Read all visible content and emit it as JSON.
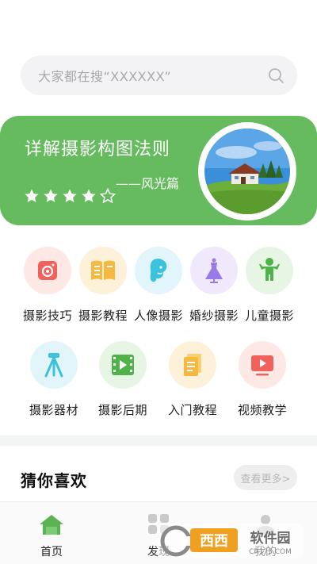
{
  "search": {
    "placeholder": "大家都在搜“XXXXXX”",
    "icon": "search-icon"
  },
  "banner": {
    "title": "详解摄影构图法则",
    "subtitle": "——风光篇",
    "rating": 4,
    "rating_max": 5,
    "bg_color": "#66bb5f"
  },
  "categories": [
    {
      "label": "摄影技巧",
      "icon": "camera-icon",
      "color": "#fde8e6"
    },
    {
      "label": "摄影教程",
      "icon": "book-icon",
      "color": "#fdf1d9"
    },
    {
      "label": "人像摄影",
      "icon": "portrait-icon",
      "color": "#e1f5fb"
    },
    {
      "label": "婚纱摄影",
      "icon": "dress-icon",
      "color": "#efe9fb"
    },
    {
      "label": "儿童摄影",
      "icon": "child-icon",
      "color": "#e6f5e4"
    },
    {
      "label": "摄影器材",
      "icon": "tripod-icon",
      "color": "#e1f5fb"
    },
    {
      "label": "摄影后期",
      "icon": "film-icon",
      "color": "#e6f5e4"
    },
    {
      "label": "入门教程",
      "icon": "document-icon",
      "color": "#fdf1d9"
    },
    {
      "label": "视频教学",
      "icon": "video-icon",
      "color": "#fde8e6"
    }
  ],
  "guess": {
    "title": "猜你喜欢",
    "more_label": "查看更多>"
  },
  "nav": {
    "items": [
      {
        "label": "首页",
        "icon": "home-icon",
        "active": true
      },
      {
        "label": "发现",
        "icon": "discover-icon",
        "active": false
      },
      {
        "label": "我的",
        "icon": "profile-icon",
        "active": false
      }
    ]
  },
  "watermark": {
    "brand": "西西",
    "text": "软件园",
    "url": "CR173.COM"
  }
}
